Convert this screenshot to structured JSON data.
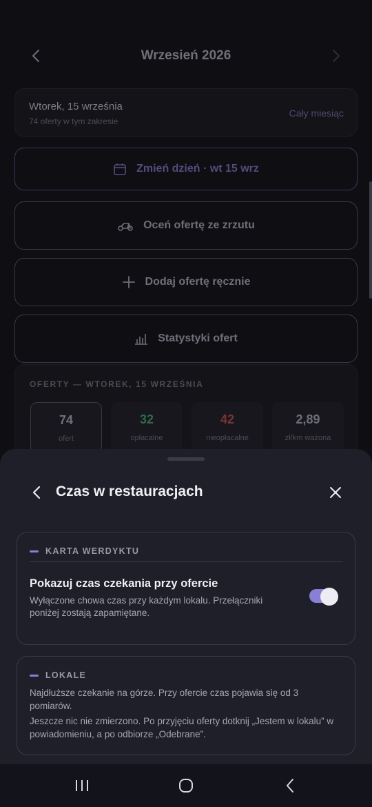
{
  "header": {
    "title": "Wrzesień 2026"
  },
  "range": {
    "day": "Wtorek, 15 września",
    "count": "74 oferty w tym zakresie",
    "month_link": "Cały miesiąc"
  },
  "actions": [
    {
      "label": "Zmień dzień · wt 15 wrz",
      "icon": "calendar-icon"
    },
    {
      "label": "Oceń ofertę ze zrzutu",
      "icon": "scooter-icon"
    },
    {
      "label": "Dodaj ofertę ręcznie",
      "icon": "plus-icon"
    },
    {
      "label": "Statystyki ofert",
      "icon": "bar-chart-icon"
    }
  ],
  "stats": {
    "label": "OFERTY — WTOREK, 15 WRZEŚNIA",
    "tiles": [
      {
        "value": "74",
        "label": "ofert",
        "color": "#6f6f78"
      },
      {
        "value": "32",
        "label": "opłacalne",
        "color": "#2f6b45"
      },
      {
        "value": "42",
        "label": "nieopłacalne",
        "color": "#7a3434"
      },
      {
        "value": "2,89",
        "label": "zł/km ważona",
        "color": "#6f6f78"
      }
    ]
  },
  "sheet": {
    "title": "Czas w restauracjach",
    "verdict": {
      "section": "KARTA WERDYKTU",
      "option_title": "Pokazuj czas czekania przy ofercie",
      "option_desc": "Wyłączone chowa czas przy każdym lokalu. Przełączniki poniżej zostają zapamiętane.",
      "toggle_on": true
    },
    "venues": {
      "section": "LOKALE",
      "p1": "Najdłuższe czekanie na górze. Przy ofercie czas pojawia się od 3 pomiarów.",
      "p2": "Jeszcze nic nie zmierzono. Po przyjęciu oferty dotknij „Jestem w lokalu” w powiadomieniu, a po odbiorze „Odebrane”."
    }
  },
  "colors": {
    "accent": "#8a7fd6",
    "sheet_bg": "#1e1f29"
  }
}
